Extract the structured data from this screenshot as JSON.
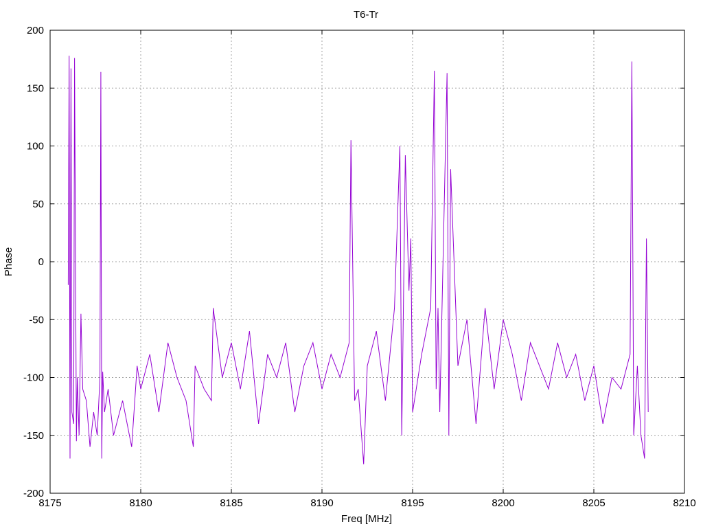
{
  "chart_data": {
    "type": "line",
    "title": "T6-Tr",
    "xlabel": "Freq [MHz]",
    "ylabel": "Phase",
    "xlim": [
      8175,
      8210
    ],
    "ylim": [
      -200,
      200
    ],
    "xticks": [
      8175,
      8180,
      8185,
      8190,
      8195,
      8200,
      8205,
      8210
    ],
    "yticks": [
      -200,
      -150,
      -100,
      -50,
      0,
      50,
      100,
      150,
      200
    ],
    "grid": true,
    "legend": "none",
    "line_color": "#9400d3",
    "series": [
      {
        "x": [
          8176.0,
          8176.05,
          8176.1,
          8176.15,
          8176.2,
          8176.3,
          8176.35,
          8176.45,
          8176.5,
          8176.6,
          8176.7,
          8176.8,
          8177.0,
          8177.2,
          8177.4,
          8177.6,
          8177.75,
          8177.8,
          8177.85,
          8177.9,
          8178.0,
          8178.2,
          8178.5,
          8179.0,
          8179.5,
          8179.8,
          8180.0,
          8180.5,
          8181.0,
          8181.5,
          8182.0,
          8182.5,
          8182.9,
          8183.0,
          8183.5,
          8183.9,
          8184.0,
          8184.5,
          8185.0,
          8185.5,
          8186.0,
          8186.5,
          8187.0,
          8187.5,
          8188.0,
          8188.5,
          8189.0,
          8189.5,
          8190.0,
          8190.5,
          8191.0,
          8191.5,
          8191.6,
          8191.7,
          8191.8,
          8192.0,
          8192.3,
          8192.5,
          8193.0,
          8193.5,
          8194.0,
          8194.3,
          8194.4,
          8194.5,
          8194.6,
          8194.8,
          8194.9,
          8195.0,
          8195.5,
          8196.0,
          8196.2,
          8196.3,
          8196.4,
          8196.5,
          8196.9,
          8197.0,
          8197.1,
          8197.5,
          8198.0,
          8198.5,
          8199.0,
          8199.5,
          8200.0,
          8200.5,
          8201.0,
          8201.5,
          8202.0,
          8202.5,
          8203.0,
          8203.5,
          8204.0,
          8204.5,
          8205.0,
          8205.5,
          8206.0,
          8206.5,
          8207.0,
          8207.1,
          8207.2,
          8207.4,
          8207.6,
          8207.8,
          8207.9,
          8208.0
        ],
        "y": [
          -20,
          178,
          -170,
          167,
          -130,
          -140,
          176,
          -155,
          -100,
          -150,
          -45,
          -110,
          -120,
          -160,
          -130,
          -150,
          -100,
          164,
          -170,
          -95,
          -130,
          -110,
          -150,
          -120,
          -160,
          -90,
          -110,
          -80,
          -130,
          -70,
          -100,
          -120,
          -160,
          -90,
          -110,
          -120,
          -40,
          -100,
          -70,
          -110,
          -60,
          -140,
          -80,
          -100,
          -70,
          -130,
          -90,
          -70,
          -110,
          -80,
          -100,
          -70,
          105,
          -8,
          -120,
          -110,
          -175,
          -90,
          -60,
          -120,
          -40,
          100,
          -150,
          -30,
          92,
          -25,
          20,
          -130,
          -80,
          -40,
          165,
          -110,
          -40,
          -130,
          163,
          -150,
          80,
          -90,
          -50,
          -140,
          -40,
          -110,
          -50,
          -80,
          -120,
          -70,
          -90,
          -110,
          -70,
          -100,
          -80,
          -120,
          -90,
          -140,
          -100,
          -110,
          -80,
          173,
          -150,
          -90,
          -150,
          -170,
          20,
          -130
        ]
      }
    ]
  }
}
